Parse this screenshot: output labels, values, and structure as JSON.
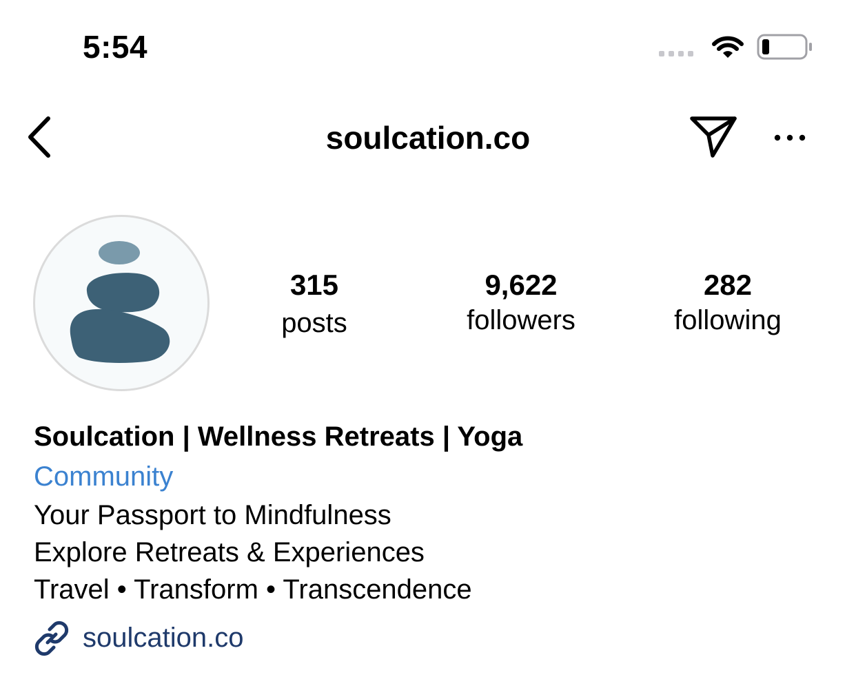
{
  "status_bar": {
    "time": "5:54"
  },
  "nav": {
    "username": "soulcation.co",
    "icons": {
      "back": "chevron-left-icon",
      "share": "paper-plane-icon",
      "more": "ellipsis-icon"
    }
  },
  "profile": {
    "avatar_colors": {
      "dark_stone": "#3d6176",
      "light_stone": "#7a9aab",
      "background": "#f7fafb"
    },
    "stats": [
      {
        "value": "315",
        "label": "posts"
      },
      {
        "value": "9,622",
        "label": "followers"
      },
      {
        "value": "282",
        "label": "following"
      }
    ],
    "bio": {
      "name": "Soulcation | Wellness Retreats | Yoga",
      "category": "Community",
      "lines": [
        "Your Passport to Mindfulness",
        "Explore Retreats & Experiences",
        "Travel • Transform • Transcendence"
      ],
      "link": "soulcation.co"
    }
  },
  "colors": {
    "category_blue": "#3b82d0",
    "link_blue": "#1f3a6b",
    "avatar_border": "#dbdbdb"
  }
}
